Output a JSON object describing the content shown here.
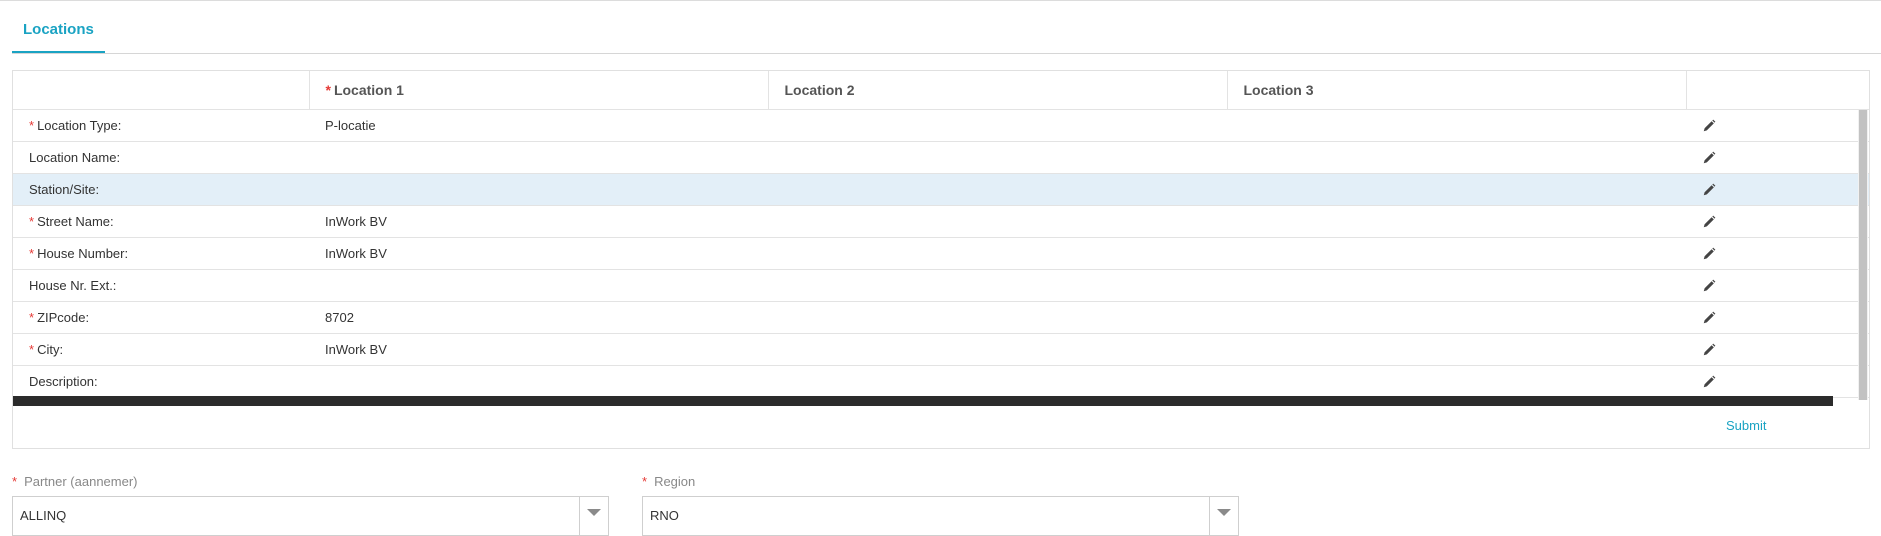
{
  "tabs": [
    {
      "label": "Locations",
      "active": true
    }
  ],
  "table": {
    "headers": [
      "",
      "Location 1",
      "Location 2",
      "Location 3",
      ""
    ],
    "required_header_index": 1,
    "rows": [
      {
        "label": "Location Type:",
        "required": true,
        "values": [
          "P-locatie",
          "",
          ""
        ]
      },
      {
        "label": "Location Name:",
        "required": false,
        "values": [
          "",
          "",
          ""
        ]
      },
      {
        "label": "Station/Site:",
        "required": false,
        "values": [
          "",
          "",
          ""
        ],
        "selected": true
      },
      {
        "label": "Street Name:",
        "required": true,
        "values": [
          "InWork BV",
          "",
          ""
        ]
      },
      {
        "label": "House Number:",
        "required": true,
        "values": [
          "InWork BV",
          "",
          ""
        ]
      },
      {
        "label": "House Nr. Ext.:",
        "required": false,
        "values": [
          "",
          "",
          ""
        ]
      },
      {
        "label": "ZIPcode:",
        "required": true,
        "values": [
          "8702",
          "",
          ""
        ]
      },
      {
        "label": "City:",
        "required": true,
        "values": [
          "InWork BV",
          "",
          ""
        ]
      },
      {
        "label": "Description:",
        "required": false,
        "values": [
          "",
          "",
          ""
        ]
      }
    ],
    "row_action_icon": "pencil-edit-icon"
  },
  "submit_label": "Submit",
  "form": {
    "partner": {
      "label": "Partner (aannemer)",
      "required": true,
      "value": "ALLINQ"
    },
    "region": {
      "label": "Region",
      "required": true,
      "value": "RNO"
    }
  },
  "required_marker": "*",
  "colors": {
    "accent": "#1aa3c3",
    "required": "#e53935",
    "selected_row": "#e3eff8",
    "border": "#e0e0e0"
  }
}
